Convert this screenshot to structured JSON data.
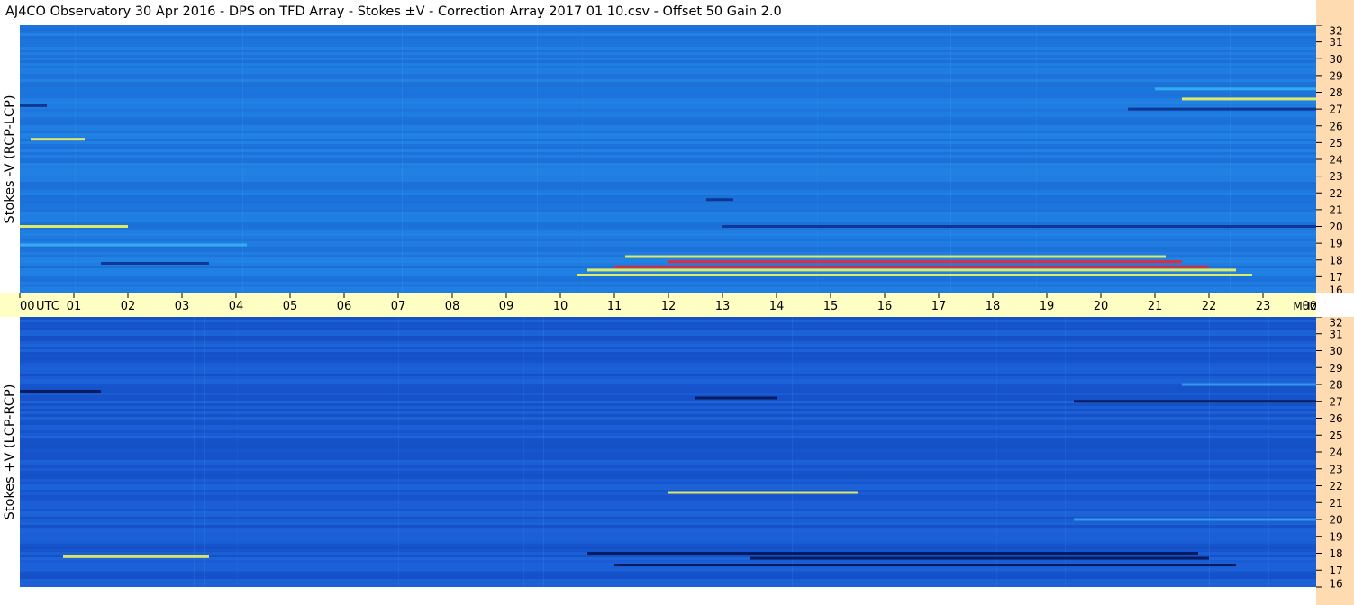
{
  "title": "AJ4CO Observatory  30 Apr 2016  -  DPS on TFD Array  -  Stokes ±V  -  Correction Array 2017 01 10.csv  -  Offset 50  Gain 2.0",
  "chart_data": [
    {
      "type": "heatmap",
      "panel": "top",
      "ylabel": "Stokes -V (RCP-LCP)",
      "x_axis": {
        "ticks": [
          "00",
          "01",
          "02",
          "03",
          "04",
          "05",
          "06",
          "07",
          "08",
          "09",
          "10",
          "11",
          "12",
          "13",
          "14",
          "15",
          "16",
          "17",
          "18",
          "19",
          "20",
          "21",
          "22",
          "23",
          "00"
        ],
        "unit_label": "UTC",
        "range": [
          0,
          24
        ]
      },
      "y_axis": {
        "ticks": [
          "16",
          "17",
          "18",
          "19",
          "20",
          "21",
          "22",
          "23",
          "24",
          "25",
          "26",
          "27",
          "28",
          "29",
          "30",
          "31",
          "32"
        ],
        "unit_label": "MHz",
        "range": [
          16,
          32
        ]
      },
      "colors": {
        "background": "#1e78e0",
        "light": "#36b6f4",
        "dark": "#0c2c88",
        "bright": "#ffff50",
        "hot": "#ff2020"
      },
      "features": [
        {
          "freq": 17.1,
          "t0": 10.3,
          "t1": 22.8,
          "kind": "bright"
        },
        {
          "freq": 17.6,
          "t0": 11.0,
          "t1": 22.0,
          "kind": "hot"
        },
        {
          "freq": 17.9,
          "t0": 12.0,
          "t1": 21.5,
          "kind": "hot"
        },
        {
          "freq": 18.2,
          "t0": 11.2,
          "t1": 21.2,
          "kind": "bright"
        },
        {
          "freq": 17.4,
          "t0": 10.5,
          "t1": 22.5,
          "kind": "bright"
        },
        {
          "freq": 20.0,
          "t0": 13.0,
          "t1": 24.0,
          "kind": "dark"
        },
        {
          "freq": 20.0,
          "t0": 0.0,
          "t1": 2.0,
          "kind": "bright"
        },
        {
          "freq": 21.6,
          "t0": 12.7,
          "t1": 13.2,
          "kind": "dark"
        },
        {
          "freq": 27.2,
          "t0": 0.0,
          "t1": 0.5,
          "kind": "dark"
        },
        {
          "freq": 27.0,
          "t0": 20.5,
          "t1": 24.0,
          "kind": "dark"
        },
        {
          "freq": 27.6,
          "t0": 21.5,
          "t1": 24.0,
          "kind": "bright"
        },
        {
          "freq": 28.2,
          "t0": 21.0,
          "t1": 24.0,
          "kind": "light"
        },
        {
          "freq": 25.2,
          "t0": 0.2,
          "t1": 1.2,
          "kind": "bright"
        },
        {
          "freq": 18.9,
          "t0": 0.0,
          "t1": 4.2,
          "kind": "light"
        },
        {
          "freq": 17.8,
          "t0": 1.5,
          "t1": 3.5,
          "kind": "dark"
        }
      ]
    },
    {
      "type": "heatmap",
      "panel": "bottom",
      "ylabel": "Stokes +V (LCP-RCP)",
      "x_axis": {
        "ticks": [
          "00",
          "01",
          "02",
          "03",
          "04",
          "05",
          "06",
          "07",
          "08",
          "09",
          "10",
          "11",
          "12",
          "13",
          "14",
          "15",
          "16",
          "17",
          "18",
          "19",
          "20",
          "21",
          "22",
          "23",
          "00"
        ],
        "unit_label": "UTC",
        "range": [
          0,
          24
        ]
      },
      "y_axis": {
        "ticks": [
          "16",
          "17",
          "18",
          "19",
          "20",
          "21",
          "22",
          "23",
          "24",
          "25",
          "26",
          "27",
          "28",
          "29",
          "30",
          "31",
          "32"
        ],
        "unit_label": "MHz",
        "range": [
          16,
          32
        ]
      },
      "colors": {
        "background": "#1858d4",
        "light": "#3aa6f0",
        "dark": "#04104a",
        "bright": "#ffff50",
        "hot": "#ff2020"
      },
      "features": [
        {
          "freq": 17.7,
          "t0": 13.5,
          "t1": 22.0,
          "kind": "dark"
        },
        {
          "freq": 18.0,
          "t0": 10.5,
          "t1": 21.8,
          "kind": "dark"
        },
        {
          "freq": 17.3,
          "t0": 11.0,
          "t1": 22.5,
          "kind": "dark"
        },
        {
          "freq": 21.6,
          "t0": 12.0,
          "t1": 15.5,
          "kind": "bright"
        },
        {
          "freq": 20.0,
          "t0": 19.5,
          "t1": 24.0,
          "kind": "light"
        },
        {
          "freq": 17.8,
          "t0": 0.8,
          "t1": 3.5,
          "kind": "bright"
        },
        {
          "freq": 27.2,
          "t0": 12.5,
          "t1": 14.0,
          "kind": "dark"
        },
        {
          "freq": 27.0,
          "t0": 19.5,
          "t1": 24.0,
          "kind": "dark"
        },
        {
          "freq": 27.6,
          "t0": 0.0,
          "t1": 1.5,
          "kind": "dark"
        },
        {
          "freq": 28.0,
          "t0": 21.5,
          "t1": 24.0,
          "kind": "light"
        }
      ]
    }
  ]
}
